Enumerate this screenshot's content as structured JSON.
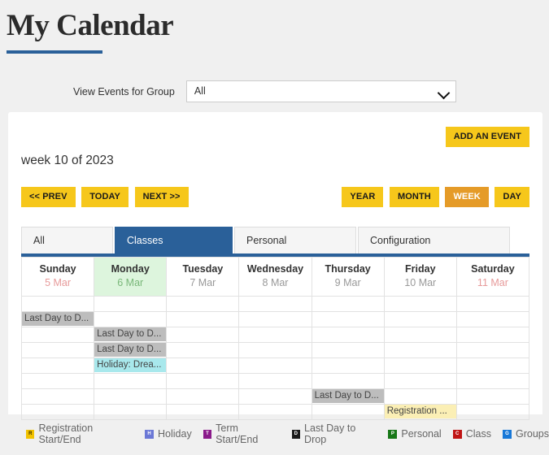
{
  "page": {
    "title": "My Calendar",
    "accent_color": "#2a6099",
    "button_color": "#f6c71b",
    "button_active_color": "#e59b28"
  },
  "filter": {
    "label": "View Events for Group",
    "selected": "All",
    "chevron_icon": "chevron-down-icon"
  },
  "toolbar": {
    "add_event_label": "ADD AN EVENT",
    "week_label": "week 10 of 2023",
    "prev_label": "<< PREV",
    "today_label": "TODAY",
    "next_label": "NEXT >>",
    "year_label": "YEAR",
    "month_label": "MONTH",
    "week_view_label": "WEEK",
    "day_label": "DAY",
    "active_view": "WEEK"
  },
  "tabs": [
    {
      "label": "All",
      "active": false
    },
    {
      "label": "Classes",
      "active": true
    },
    {
      "label": "Personal",
      "active": false
    },
    {
      "label": "Configuration",
      "active": false
    }
  ],
  "calendar": {
    "days": [
      {
        "name": "Sunday",
        "date": "5 Mar",
        "weekend": true,
        "today": false
      },
      {
        "name": "Monday",
        "date": "6 Mar",
        "weekend": false,
        "today": true
      },
      {
        "name": "Tuesday",
        "date": "7 Mar",
        "weekend": false,
        "today": false
      },
      {
        "name": "Wednesday",
        "date": "8 Mar",
        "weekend": false,
        "today": false
      },
      {
        "name": "Thursday",
        "date": "9 Mar",
        "weekend": false,
        "today": false
      },
      {
        "name": "Friday",
        "date": "10 Mar",
        "weekend": false,
        "today": false
      },
      {
        "name": "Saturday",
        "date": "11 Mar",
        "weekend": true,
        "today": false
      }
    ],
    "rows": [
      [
        null,
        null,
        null,
        null,
        null,
        null,
        null
      ],
      [
        {
          "text": "Last Day to D...",
          "kind": "drop"
        },
        null,
        null,
        null,
        null,
        null,
        null
      ],
      [
        null,
        {
          "text": "Last Day to D...",
          "kind": "drop"
        },
        null,
        null,
        null,
        null,
        null
      ],
      [
        null,
        {
          "text": "Last Day to D...",
          "kind": "drop"
        },
        null,
        null,
        null,
        null,
        null
      ],
      [
        null,
        {
          "text": "Holiday: Drea...",
          "kind": "holiday"
        },
        null,
        null,
        null,
        null,
        null
      ],
      [
        null,
        null,
        null,
        null,
        null,
        null,
        null
      ],
      [
        null,
        null,
        null,
        null,
        {
          "text": "Last Day to D...",
          "kind": "drop"
        },
        null,
        null
      ],
      [
        null,
        null,
        null,
        null,
        null,
        {
          "text": "Registration ...",
          "kind": "registration"
        },
        null
      ]
    ]
  },
  "legend": [
    {
      "label": "Registration Start/End",
      "glyph": "R",
      "bg": "#f2c200",
      "fg": "#3a2e00"
    },
    {
      "label": "Holiday",
      "glyph": "H",
      "bg": "#6b78d6",
      "fg": "#ffffff"
    },
    {
      "label": "Term Start/End",
      "glyph": "T",
      "bg": "#8a1a8a",
      "fg": "#ffffff"
    },
    {
      "label": "Last Day to Drop",
      "glyph": "D",
      "bg": "#1a1a1a",
      "fg": "#ffffff"
    },
    {
      "label": "Personal",
      "glyph": "P",
      "bg": "#177717",
      "fg": "#ffffff"
    },
    {
      "label": "Class",
      "glyph": "C",
      "bg": "#c01414",
      "fg": "#ffffff"
    },
    {
      "label": "Groups",
      "glyph": "G",
      "bg": "#1878d8",
      "fg": "#ffffff"
    }
  ]
}
